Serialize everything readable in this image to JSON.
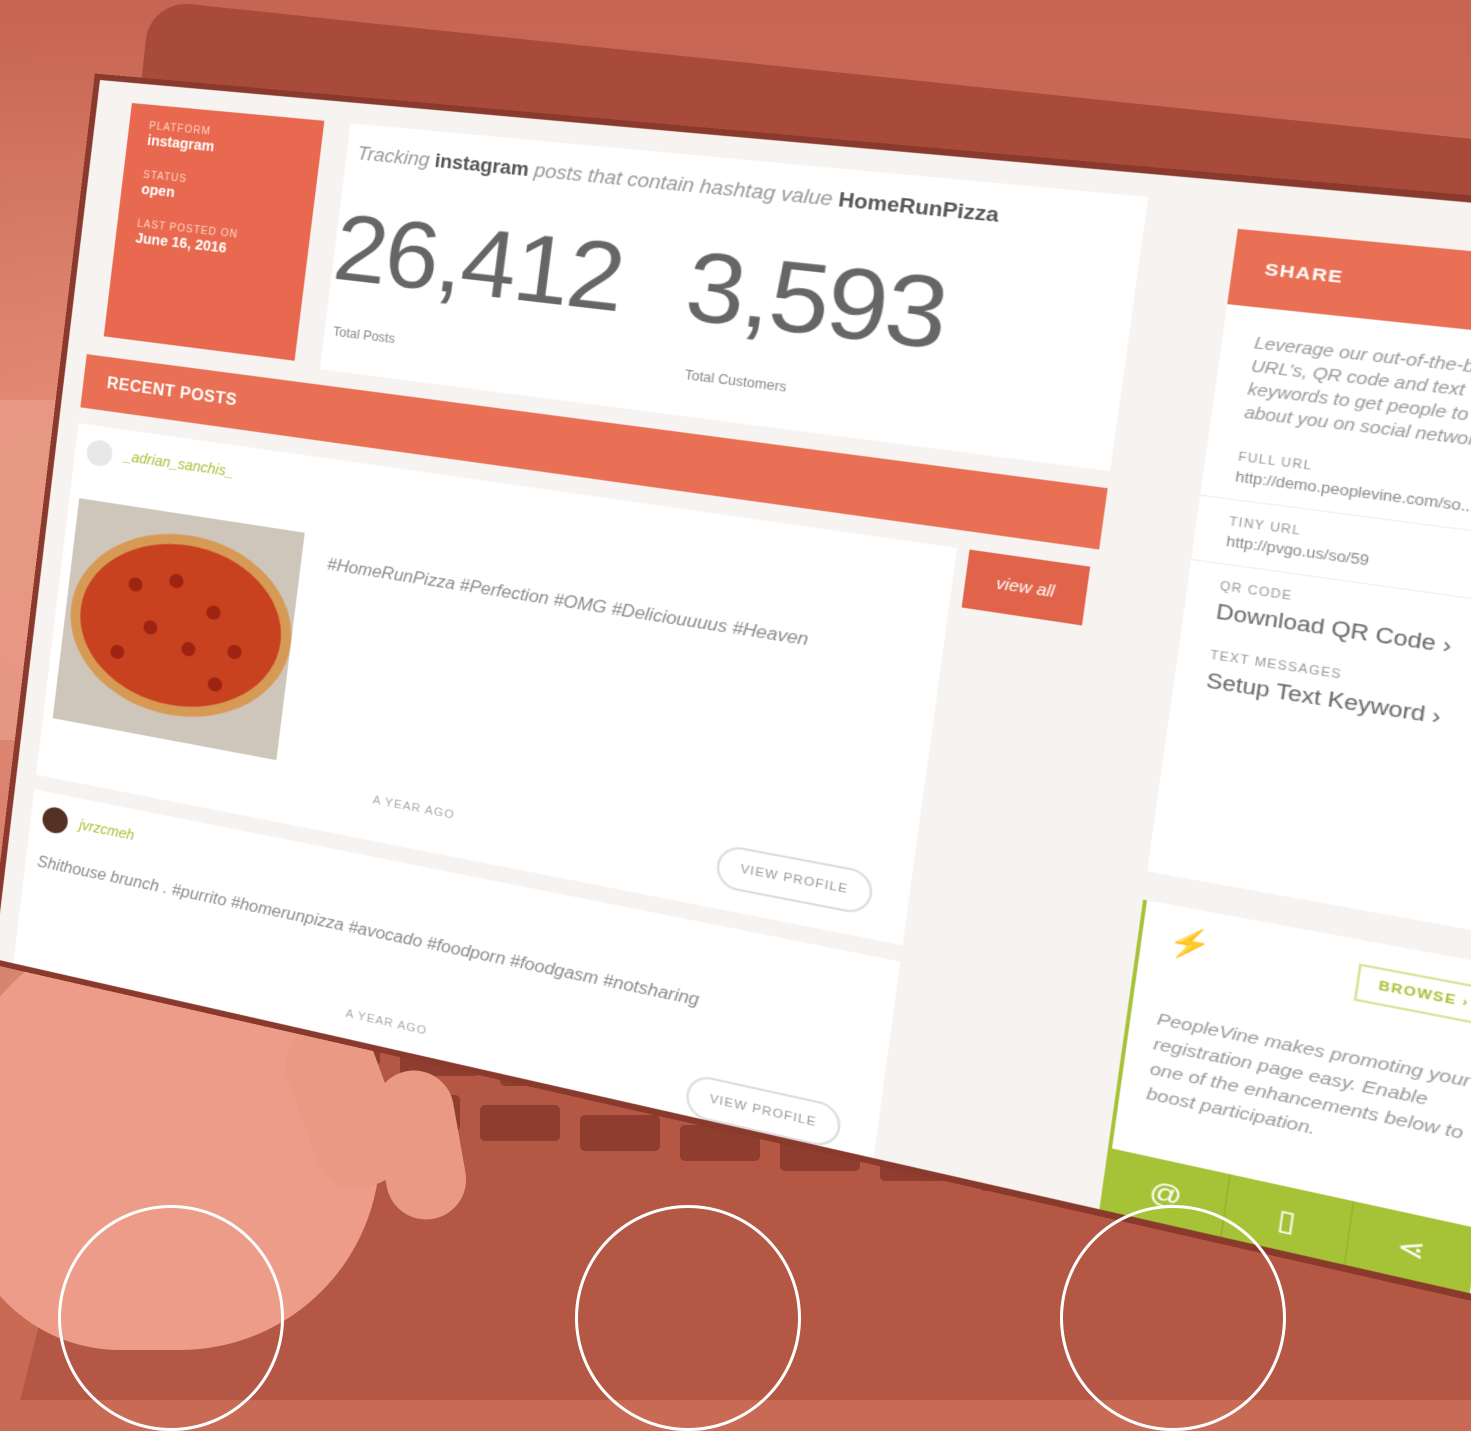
{
  "info": {
    "platform_label": "PLATFORM",
    "platform_value": "instagram",
    "status_label": "STATUS",
    "status_value": "open",
    "last_posted_label": "LAST POSTED ON",
    "last_posted_value": "June 16, 2016"
  },
  "tracking": {
    "prefix": "Tracking",
    "platform": "instagram",
    "middle": "posts that contain hashtag value",
    "hashtag": "HomeRunPizza"
  },
  "stats": {
    "posts_value": "26,412",
    "posts_label": "Total Posts",
    "customers_value": "3,593",
    "customers_label": "Total Customers"
  },
  "recent": {
    "title": "RECENT POSTS",
    "view_all": "view all"
  },
  "posts": [
    {
      "username": "_adrian_sanchis_",
      "text": "#HomeRunPizza #Perfection #OMG #Deliciouuuus #Heaven",
      "ago": "A YEAR AGO",
      "button": "VIEW PROFILE"
    },
    {
      "username": "jvrzcmeh",
      "text": "Shithouse brunch . #purrito #homerunpizza #avocado #foodporn #foodgasm #notsharing",
      "ago": "A YEAR AGO",
      "button": "VIEW PROFILE"
    }
  ],
  "share": {
    "title": "SHARE",
    "description": "Leverage our out-of-the-box URL's, QR code and text keywords to get people to talk about you on social networks.",
    "full_url_label": "FULL URL",
    "full_url_value": "http://demo.peoplevine.com/so...",
    "tiny_url_label": "TINY URL",
    "tiny_url_value": "http://pvgo.us/so/59",
    "qr_label": "QR CODE",
    "qr_action": "Download QR Code",
    "text_label": "TEXT MESSAGES",
    "text_action": "Setup Text Keyword"
  },
  "promo": {
    "browse": "BROWSE",
    "text": "PeopleVine makes promoting your registration page easy. Enable one of the enhancements below to boost participation.",
    "icons": [
      "at-icon",
      "phone-icon",
      "share-icon"
    ]
  },
  "colors": {
    "accent": "#ea7055",
    "green": "#a6c236",
    "background": "#c96a55"
  }
}
